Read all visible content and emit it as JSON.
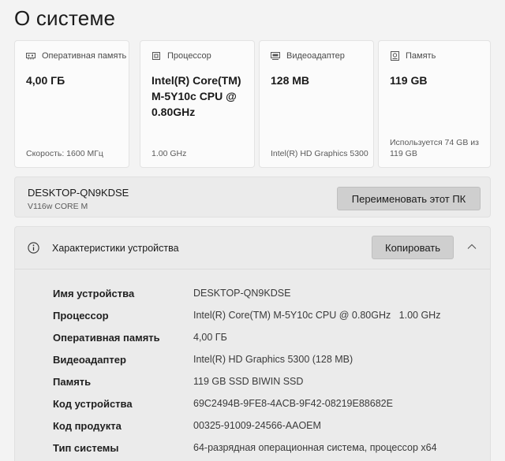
{
  "page": {
    "title": "О системе"
  },
  "cards": [
    {
      "icon": "ram-icon",
      "label": "Оперативная память",
      "value": "4,00 ГБ",
      "foot": "Скорость: 1600 МГц"
    },
    {
      "icon": "processor-icon",
      "label": "Процессор",
      "value": "Intel(R) Core(TM) M-5Y10c CPU @ 0.80GHz",
      "foot": "1.00 GHz"
    },
    {
      "icon": "display-adapter-icon",
      "label": "Видеоадаптер",
      "value": "128 MB",
      "foot": "Intel(R) HD Graphics 5300"
    },
    {
      "icon": "storage-icon",
      "label": "Память",
      "value": "119 GB",
      "foot": "Используется 74 GB из 119 GB"
    }
  ],
  "device": {
    "name": "DESKTOP-QN9KDSE",
    "model": "V116w CORE M",
    "rename_label": "Переименовать этот ПК"
  },
  "specs": {
    "title": "Характеристики устройства",
    "copy_label": "Копировать",
    "rows": [
      {
        "label": "Имя устройства",
        "value": "DESKTOP-QN9KDSE"
      },
      {
        "label": "Процессор",
        "value": "Intel(R) Core(TM) M-5Y10c CPU @ 0.80GHz   1.00 GHz"
      },
      {
        "label": "Оперативная память",
        "value": "4,00 ГБ"
      },
      {
        "label": "Видеоадаптер",
        "value": "Intel(R) HD Graphics 5300 (128 MB)"
      },
      {
        "label": "Память",
        "value": "119 GB SSD BIWIN SSD"
      },
      {
        "label": "Код устройства",
        "value": "69C2494B-9FE8-4ACB-9F42-08219E88682E"
      },
      {
        "label": "Код продукта",
        "value": "00325-91009-24566-AAOEM"
      },
      {
        "label": "Тип системы",
        "value": "64-разрядная операционная система, процессор x64"
      }
    ]
  }
}
